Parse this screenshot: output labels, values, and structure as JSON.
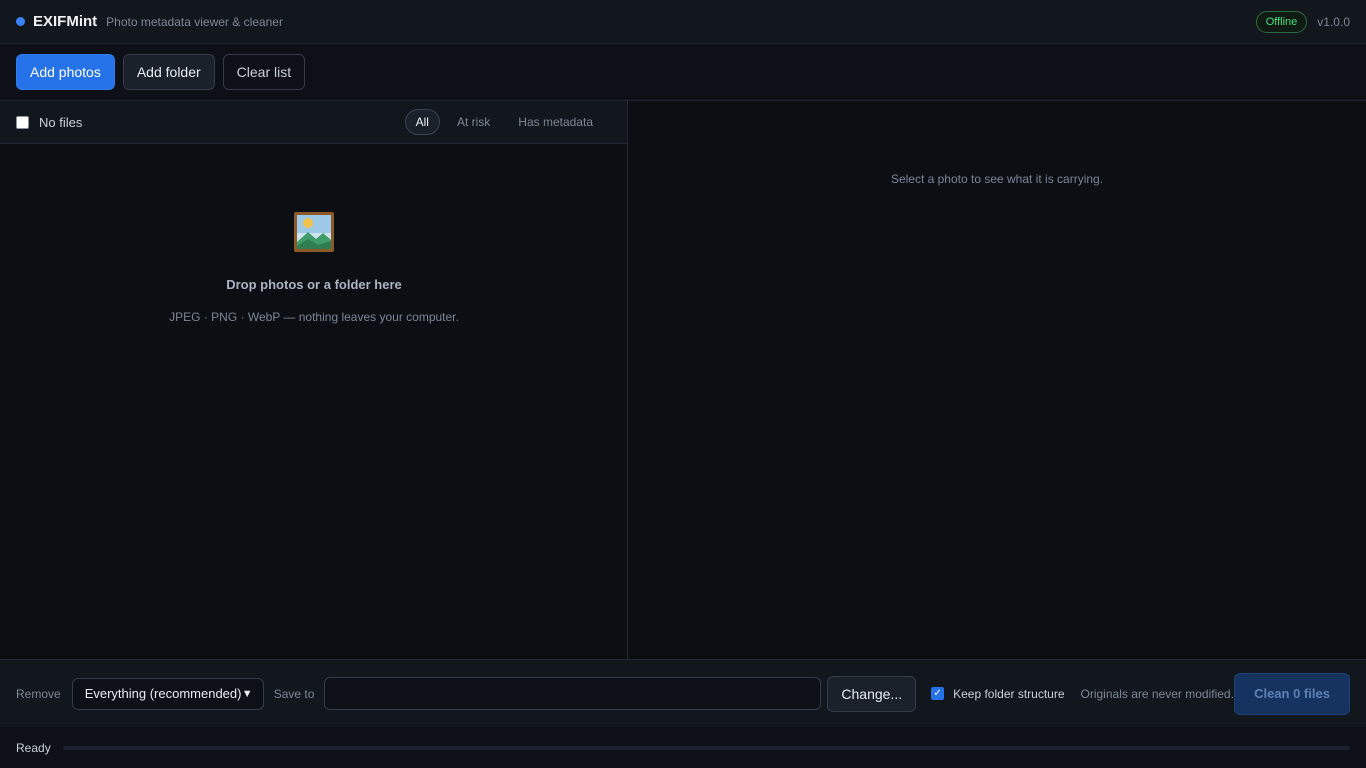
{
  "titlebar": {
    "app_name": "EXIFMint",
    "tagline": "Photo metadata viewer & cleaner",
    "status_badge": "Offline",
    "version": "v1.0.0"
  },
  "toolbar": {
    "add_photos_label": "Add photos",
    "add_folder_label": "Add folder",
    "clear_list_label": "Clear list"
  },
  "file_list": {
    "select_all_checked": false,
    "count_label": "No files",
    "filters": [
      {
        "label": "All",
        "active": true
      },
      {
        "label": "At risk",
        "active": false
      },
      {
        "label": "Has metadata",
        "active": false
      }
    ],
    "empty_icon": "framed-picture-icon",
    "empty_title": "Drop photos or a folder here",
    "empty_subtitle": "JPEG · PNG · WebP — nothing leaves your computer."
  },
  "details": {
    "hint": "Select a photo to see what it is carrying."
  },
  "actions": {
    "remove_label": "Remove",
    "remove_selected": "Everything (recommended)",
    "save_to_label": "Save to",
    "save_to_value": "",
    "change_label": "Change...",
    "keep_structure_label": "Keep folder structure",
    "keep_structure_checked": true,
    "originals_note": "Originals are never modified.",
    "clean_label": "Clean 0 files"
  },
  "statusbar": {
    "status": "Ready",
    "progress": 0
  },
  "colors": {
    "accent": "#2672e8",
    "online_badge": "#4ade80",
    "background": "#0b0e13"
  }
}
